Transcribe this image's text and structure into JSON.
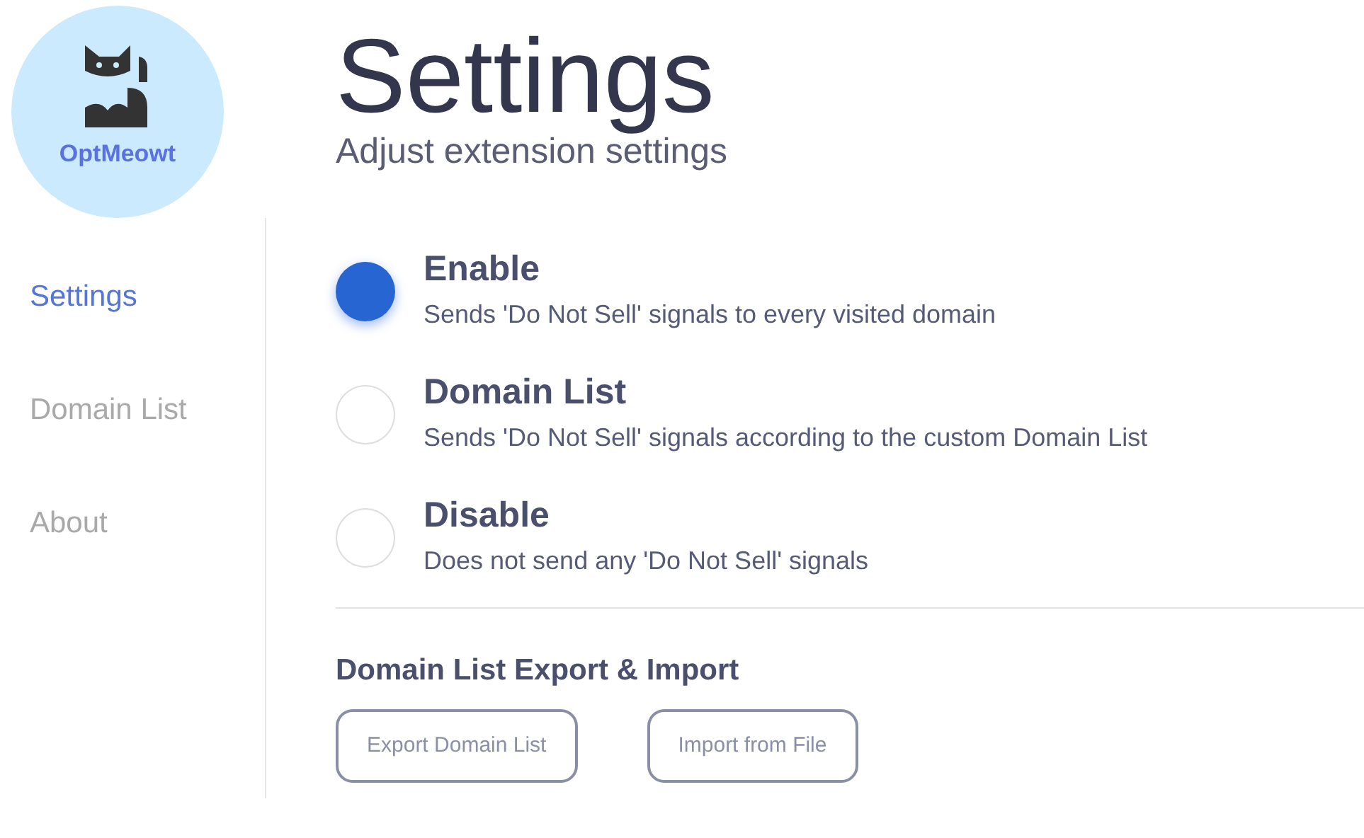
{
  "logo": {
    "label": "OptMeowt"
  },
  "sidebar": {
    "items": [
      {
        "label": "Settings",
        "selected": true
      },
      {
        "label": "Domain List",
        "selected": false
      },
      {
        "label": "About",
        "selected": false
      }
    ]
  },
  "header": {
    "title": "Settings",
    "subtitle": "Adjust extension settings"
  },
  "modes": [
    {
      "title": "Enable",
      "description": "Sends 'Do Not Sell' signals to every visited domain",
      "selected": true
    },
    {
      "title": "Domain List",
      "description": "Sends 'Do Not Sell' signals according to the custom Domain List",
      "selected": false
    },
    {
      "title": "Disable",
      "description": "Does not send any 'Do Not Sell' signals",
      "selected": false
    }
  ],
  "export_import": {
    "heading": "Domain List Export & Import",
    "buttons": [
      "Export Domain List",
      "Import from File"
    ]
  }
}
